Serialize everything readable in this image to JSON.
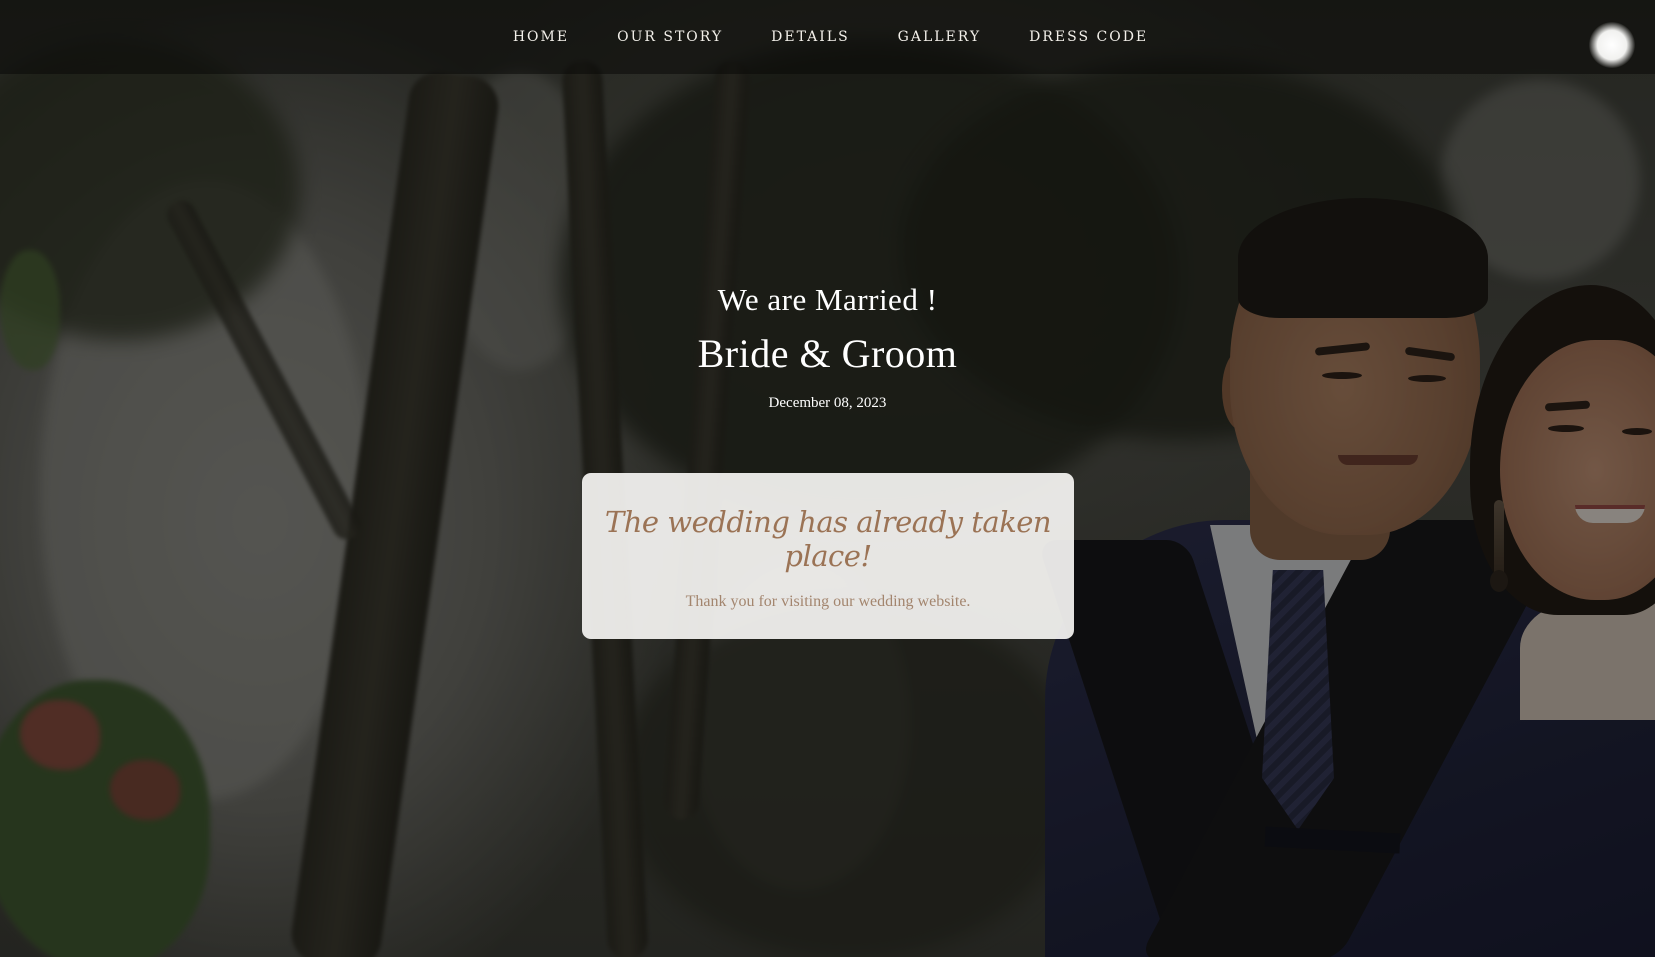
{
  "nav": {
    "items": [
      {
        "label": "HOME"
      },
      {
        "label": "OUR STORY"
      },
      {
        "label": "DETAILS"
      },
      {
        "label": "GALLERY"
      },
      {
        "label": "DRESS CODE"
      }
    ]
  },
  "hero": {
    "subtitle": "We are Married !",
    "names": "Bride & Groom",
    "date": "December 08, 2023"
  },
  "notice": {
    "title": "The wedding has already taken place!",
    "body": "Thank you for visiting our wedding website."
  },
  "colors": {
    "accent_text": "#9b7355",
    "card_background": "#f5f4f2",
    "nav_text": "#f2efe9"
  }
}
